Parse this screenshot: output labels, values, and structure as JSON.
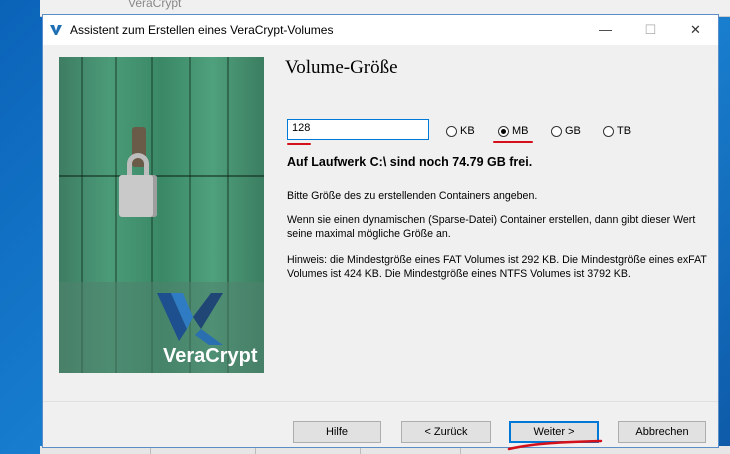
{
  "background_window": {
    "title": "VeraCrypt"
  },
  "window": {
    "title": "Assistent zum Erstellen eines VeraCrypt-Volumes",
    "minimize_glyph": "—",
    "maximize_glyph": "☐",
    "close_glyph": "✕"
  },
  "banner": {
    "brand": "VeraCrypt"
  },
  "page": {
    "heading": "Volume-Größe",
    "size_value": "128",
    "units": [
      {
        "label": "KB",
        "selected": false
      },
      {
        "label": "MB",
        "selected": true
      },
      {
        "label": "GB",
        "selected": false
      },
      {
        "label": "TB",
        "selected": false
      }
    ],
    "free_space": "Auf Laufwerk C:\\ sind noch 74.79 GB frei.",
    "hint_1": "Bitte Größe des zu erstellenden Containers angeben.",
    "hint_2": "Wenn sie einen dynamischen (Sparse-Datei) Container erstellen, dann gibt dieser Wert seine maximal mögliche Größe an.",
    "hint_3": "Hinweis: die Mindestgröße eines FAT Volumes ist 292 KB. Die Mindestgröße eines exFAT Volumes ist 424 KB. Die Mindestgröße eines NTFS Volumes ist 3792 KB."
  },
  "buttons": {
    "help": "Hilfe",
    "back": "< Zurück",
    "next": "Weiter >",
    "cancel": "Abbrechen"
  },
  "colors": {
    "accent": "#0078d7",
    "annotation": "#d4101a"
  }
}
